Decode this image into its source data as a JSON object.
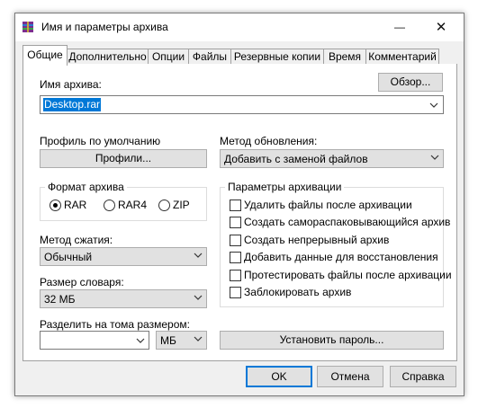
{
  "window": {
    "title": "Имя и параметры архива",
    "minimize": "—",
    "close": "✕"
  },
  "tabs": [
    "Общие",
    "Дополнительно",
    "Опции",
    "Файлы",
    "Резервные копии",
    "Время",
    "Комментарий"
  ],
  "general": {
    "archive_name_label": "Имя архива:",
    "browse_button": "Обзор...",
    "archive_name_value": "Desktop.rar",
    "default_profile_label": "Профиль по умолчанию",
    "profiles_button": "Профили...",
    "update_method_label": "Метод обновления:",
    "update_method_value": "Добавить с заменой файлов",
    "archive_format_label": "Формат архива",
    "formats": [
      "RAR",
      "RAR4",
      "ZIP"
    ],
    "selected_format": "RAR",
    "compression_method_label": "Метод сжатия:",
    "compression_method_value": "Обычный",
    "dictionary_size_label": "Размер словаря:",
    "dictionary_size_value": "32 МБ",
    "split_label": "Разделить на тома размером:",
    "split_value": "",
    "split_unit": "МБ",
    "set_password_button": "Установить пароль...",
    "archiving_options_label": "Параметры архивации",
    "options": [
      {
        "label": "Удалить файлы после архивации",
        "checked": false
      },
      {
        "label": "Создать самораспаковывающийся архив",
        "checked": false
      },
      {
        "label": "Создать непрерывный архив",
        "checked": false
      },
      {
        "label": "Добавить данные для восстановления",
        "checked": false
      },
      {
        "label": "Протестировать файлы после архивации",
        "checked": false
      },
      {
        "label": "Заблокировать архив",
        "checked": false
      }
    ]
  },
  "buttons": {
    "ok": "OK",
    "cancel": "Отмена",
    "help": "Справка"
  },
  "colors": {
    "accent": "#0078d7",
    "selection": "#0078d7",
    "window_bg": "#f0f0f0"
  }
}
